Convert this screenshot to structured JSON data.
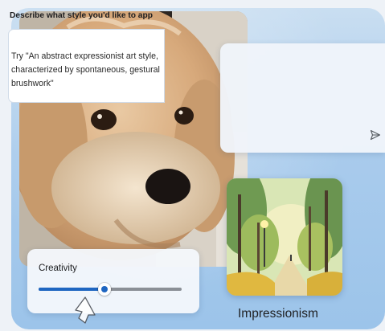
{
  "prompt_panel": {
    "title": "Describe what style you'd like to app",
    "text": "Try \"An abstract expressionist art style, characterized by spontaneous, gestural brushwork\"",
    "send_icon": "send-icon"
  },
  "style_preset": {
    "name": "Impressionism"
  },
  "creativity": {
    "label": "Creativity",
    "value": 0.46
  },
  "colors": {
    "accent": "#1f66c1",
    "panel_background": "#a9cbec"
  }
}
